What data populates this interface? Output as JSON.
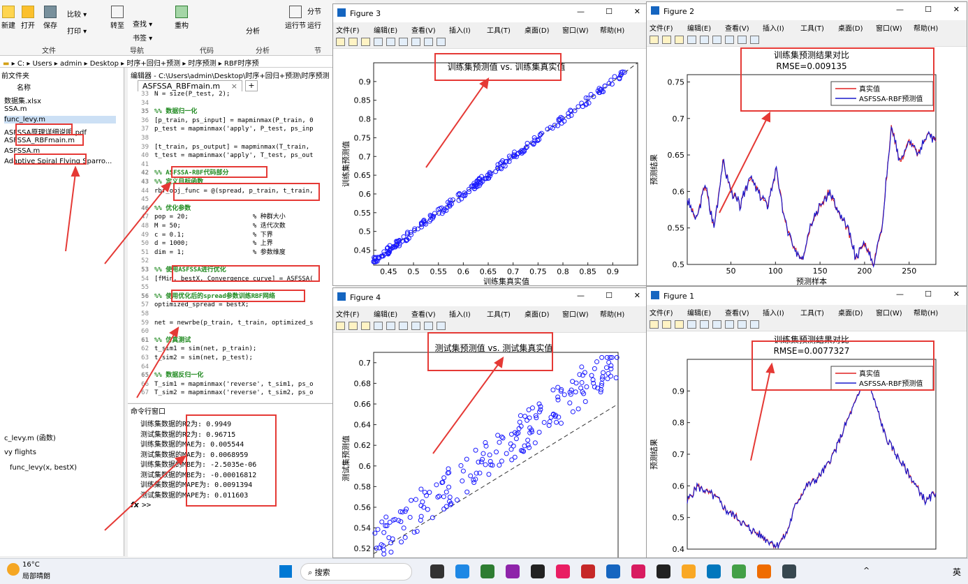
{
  "matlab": {
    "ribbon": {
      "buttons": [
        "新建",
        "打开",
        "保存",
        "比较",
        "打印",
        "转至",
        "查找",
        "书签",
        "重构",
        "分析",
        "运行节",
        "分节",
        "运行"
      ],
      "sections": [
        "文件",
        "导航",
        "代码",
        "分析",
        "节"
      ]
    },
    "address": {
      "parts": [
        "C:",
        "Users",
        "admin",
        "Desktop",
        "时序+回归+预测",
        "时序预测",
        "RBF时序预"
      ]
    },
    "filepanel": {
      "title": "前文件夹",
      "header": "名称",
      "files": [
        "数据集.xlsx",
        "SSA.m",
        "func_levy.m",
        "ASFSSA原理详细说明.pdf",
        "ASFSSA_RBFmain.m",
        "ASFSSA.m",
        "Adaptive Spiral Flying Sparro..."
      ],
      "detail_title": "c_levy.m  (函数)",
      "detail_line1": "vy flights",
      "detail_line2": "func_levy(x, bestX)"
    },
    "editor": {
      "title": "编辑器 - C:\\Users\\admin\\Desktop\\时序+回归+预测\\时序预测",
      "tab": "ASFSSA_RBFmain.m",
      "close": "×",
      "add": "+",
      "lines": [
        {
          "n": "33",
          "t": "N = size(P_test, 2);"
        },
        {
          "n": "34",
          "t": ""
        },
        {
          "n": "35",
          "t": "%% 数据归一化",
          "c": true
        },
        {
          "n": "36",
          "t": "[p_train, ps_input] = mapminmax(P_train, 0"
        },
        {
          "n": "37",
          "t": "p_test = mapminmax('apply', P_test, ps_inp"
        },
        {
          "n": "38",
          "t": ""
        },
        {
          "n": "39",
          "t": "[t_train, ps_output] = mapminmax(T_train,"
        },
        {
          "n": "40",
          "t": "t_test = mapminmax('apply', T_test, ps_out"
        },
        {
          "n": "41",
          "t": ""
        },
        {
          "n": "42",
          "t": "%% ASFSSA-RBF代码部分",
          "c": true
        },
        {
          "n": "43",
          "t": "%% 定义目标函数",
          "c": true
        },
        {
          "n": "44",
          "t": "rbf_obj_func = @(spread, p_train, t_train,"
        },
        {
          "n": "45",
          "t": ""
        },
        {
          "n": "46",
          "t": "%% 优化参数",
          "c": true
        },
        {
          "n": "47",
          "t": "pop = 20;                 % 种群大小"
        },
        {
          "n": "48",
          "t": "M = 50;                   % 迭代次数"
        },
        {
          "n": "49",
          "t": "c = 0.1;                  % 下界"
        },
        {
          "n": "50",
          "t": "d = 1000;                 % 上界"
        },
        {
          "n": "51",
          "t": "dim = 1;                  % 参数维度"
        },
        {
          "n": "52",
          "t": ""
        },
        {
          "n": "53",
          "t": "%% 使用ASFSSA进行优化",
          "c": true
        },
        {
          "n": "54",
          "t": "[fMin, bestX, Convergence_curve] = ASFSSA("
        },
        {
          "n": "55",
          "t": ""
        },
        {
          "n": "56",
          "t": "%% 使用优化后的spread参数训练RBF网络",
          "c": true
        },
        {
          "n": "57",
          "t": "optimized_spread = bestX;"
        },
        {
          "n": "58",
          "t": ""
        },
        {
          "n": "59",
          "t": "net = newrbe(p_train, t_train, optimized_s"
        },
        {
          "n": "60",
          "t": ""
        },
        {
          "n": "61",
          "t": "%% 仿真测试",
          "c": true
        },
        {
          "n": "62",
          "t": "t_sim1 = sim(net, p_train);"
        },
        {
          "n": "63",
          "t": "t_sim2 = sim(net, p_test);"
        },
        {
          "n": "64",
          "t": ""
        },
        {
          "n": "65",
          "t": "%% 数据反归一化",
          "c": true
        },
        {
          "n": "66",
          "t": "T_sim1 = mapminmax('reverse', t_sim1, ps_o"
        },
        {
          "n": "67",
          "t": "T_sim2 = mapminmax('reverse', t_sim2, ps_o"
        }
      ]
    },
    "cmd": {
      "title": "命令行窗口",
      "lines": [
        "训练集数据的R2为: 0.9949",
        "测试集数据的R2为: 0.96715",
        "训练集数据的MAE为: 0.005544",
        "测试集数据的MAE为: 0.0068959",
        "训练集数据的MBE为: -2.5035e-06",
        "测试集数据的MBE为: -0.00016812",
        "训练集数据的MAPE为: 0.0091394",
        "测试集数据的MAPE为: 0.011603"
      ],
      "prompt": ">>",
      "fx": "fx"
    }
  },
  "figure_menu": [
    "文件(F)",
    "编辑(E)",
    "查看(V)",
    "插入(I)",
    "工具(T)",
    "桌面(D)",
    "窗口(W)",
    "帮助(H)"
  ],
  "fig3": {
    "title": "Figure 3",
    "plot_title": "训练集预测值 vs. 训练集真实值",
    "xlabel": "训练集真实值",
    "ylabel": "训练集预测值"
  },
  "fig4": {
    "title": "Figure 4",
    "plot_title": "测试集预测值 vs. 测试集真实值",
    "ylabel": "测试集预测值"
  },
  "fig2": {
    "title": "Figure 2",
    "plot_title": "训练集预测结果对比",
    "rmse": "RMSE=0.009135",
    "xlabel": "预测样本",
    "ylabel": "预测结果",
    "legend": [
      "真实值",
      "ASFSSA-RBF预测值"
    ]
  },
  "fig1": {
    "title": "Figure 1",
    "plot_title": "训练集预测结果对比",
    "rmse": "RMSE=0.0077327",
    "ylabel": "预测结果",
    "legend": [
      "真实值",
      "ASFSSA-RBF预测值"
    ]
  },
  "taskbar": {
    "weather_temp": "16°C",
    "weather_desc": "局部晴朗",
    "search": "搜索",
    "ime": "英"
  },
  "colors": {
    "red": "#e53935",
    "true_line": "#e02020",
    "pred_line": "#1a1acc",
    "scatter": "#1a1aff"
  },
  "chart_data": [
    {
      "type": "scatter",
      "title": "训练集预测值 vs. 训练集真实值",
      "xlabel": "训练集真实值",
      "ylabel": "训练集预测值",
      "xlim": [
        0.42,
        0.95
      ],
      "ylim": [
        0.41,
        0.95
      ],
      "xticks": [
        0.45,
        0.5,
        0.55,
        0.6,
        0.65,
        0.7,
        0.75,
        0.8,
        0.85,
        0.9
      ],
      "yticks": [
        0.45,
        0.5,
        0.55,
        0.6,
        0.65,
        0.7,
        0.75,
        0.8,
        0.85,
        0.9
      ],
      "x": [
        0.42,
        0.44,
        0.46,
        0.48,
        0.5,
        0.52,
        0.54,
        0.56,
        0.58,
        0.6,
        0.62,
        0.64,
        0.66,
        0.68,
        0.7,
        0.72,
        0.74,
        0.76,
        0.78,
        0.8,
        0.82,
        0.84,
        0.86,
        0.88,
        0.9,
        0.92,
        0.94
      ],
      "y": [
        0.42,
        0.44,
        0.46,
        0.48,
        0.5,
        0.52,
        0.54,
        0.56,
        0.58,
        0.6,
        0.62,
        0.64,
        0.66,
        0.68,
        0.7,
        0.72,
        0.74,
        0.76,
        0.78,
        0.8,
        0.82,
        0.84,
        0.86,
        0.88,
        0.9,
        0.92,
        0.94
      ]
    },
    {
      "type": "scatter",
      "title": "测试集预测值 vs. 测试集真实值",
      "ylabel": "测试集预测值",
      "ylim": [
        0.51,
        0.71
      ],
      "yticks": [
        0.52,
        0.54,
        0.56,
        0.58,
        0.6,
        0.62,
        0.64,
        0.66,
        0.68,
        0.7
      ],
      "y": [
        0.515,
        0.53,
        0.545,
        0.56,
        0.575,
        0.59,
        0.605,
        0.62,
        0.635,
        0.65,
        0.665,
        0.68,
        0.695
      ]
    },
    {
      "type": "line",
      "title": "训练集预测结果对比",
      "subtitle": "RMSE=0.009135",
      "xlabel": "预测样本",
      "ylabel": "预测结果",
      "xlim": [
        1,
        280
      ],
      "ylim": [
        0.5,
        0.76
      ],
      "xticks": [
        50,
        100,
        150,
        200,
        250
      ],
      "yticks": [
        0.5,
        0.55,
        0.6,
        0.65,
        0.7,
        0.75
      ],
      "series": [
        {
          "name": "真实值"
        },
        {
          "name": "ASFSSA-RBF预测值"
        }
      ],
      "x": [
        1,
        10,
        20,
        30,
        40,
        50,
        60,
        70,
        80,
        90,
        100,
        110,
        120,
        130,
        140,
        150,
        160,
        170,
        180,
        190,
        200,
        210,
        220,
        230,
        240,
        250,
        260,
        270,
        280
      ],
      "values": [
        0.59,
        0.56,
        0.61,
        0.55,
        0.64,
        0.6,
        0.58,
        0.62,
        0.6,
        0.58,
        0.63,
        0.56,
        0.52,
        0.51,
        0.56,
        0.58,
        0.6,
        0.57,
        0.55,
        0.51,
        0.53,
        0.5,
        0.56,
        0.69,
        0.64,
        0.67,
        0.65,
        0.68,
        0.67
      ]
    },
    {
      "type": "line",
      "title": "训练集预测结果对比",
      "subtitle": "RMSE=0.0077327",
      "ylabel": "预测结果",
      "ylim": [
        0.4,
        1.0
      ],
      "yticks": [
        0.4,
        0.5,
        0.6,
        0.7,
        0.8,
        0.9
      ],
      "series": [
        {
          "name": "真实值"
        },
        {
          "name": "ASFSSA-RBF预测值"
        }
      ],
      "values": [
        0.55,
        0.6,
        0.58,
        0.56,
        0.52,
        0.5,
        0.47,
        0.45,
        0.43,
        0.41,
        0.45,
        0.55,
        0.6,
        0.62,
        0.66,
        0.72,
        0.8,
        0.87,
        0.95,
        0.85,
        0.75,
        0.7,
        0.65,
        0.6,
        0.55,
        0.58
      ]
    }
  ]
}
